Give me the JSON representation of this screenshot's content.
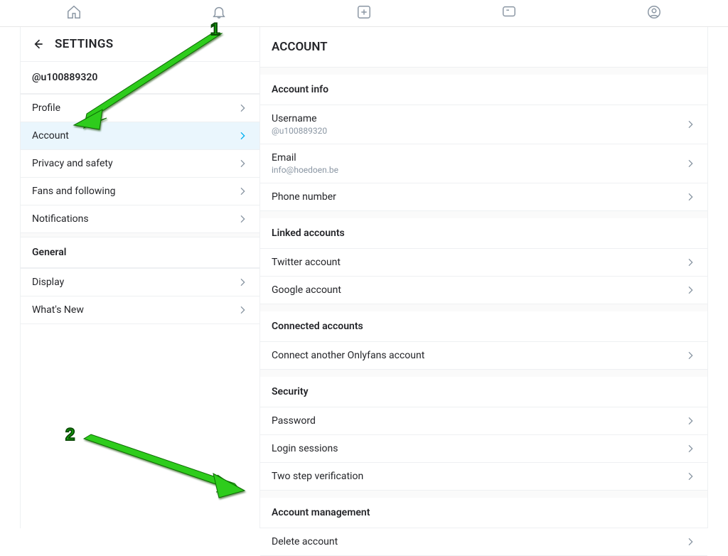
{
  "sidebar_title": "SETTINGS",
  "username": "@u100889320",
  "nav": {
    "profile": "Profile",
    "account": "Account",
    "privacy": "Privacy and safety",
    "fans": "Fans and following",
    "notifications": "Notifications"
  },
  "general_header": "General",
  "general": {
    "display": "Display",
    "whatsnew": "What's New"
  },
  "main_title": "ACCOUNT",
  "groups": {
    "account_info": "Account info",
    "linked_accounts": "Linked accounts",
    "connected_accounts": "Connected accounts",
    "security": "Security",
    "account_management": "Account management"
  },
  "rows": {
    "username_label": "Username",
    "username_value": "@u100889320",
    "email_label": "Email",
    "email_value": "info@hoedoen.be",
    "phone_label": "Phone number",
    "twitter": "Twitter account",
    "google": "Google account",
    "connect_another": "Connect another Onlyfans account",
    "password": "Password",
    "login_sessions": "Login sessions",
    "two_step": "Two step verification",
    "delete_account": "Delete account"
  },
  "annotations": {
    "one": "1",
    "two": "2"
  }
}
